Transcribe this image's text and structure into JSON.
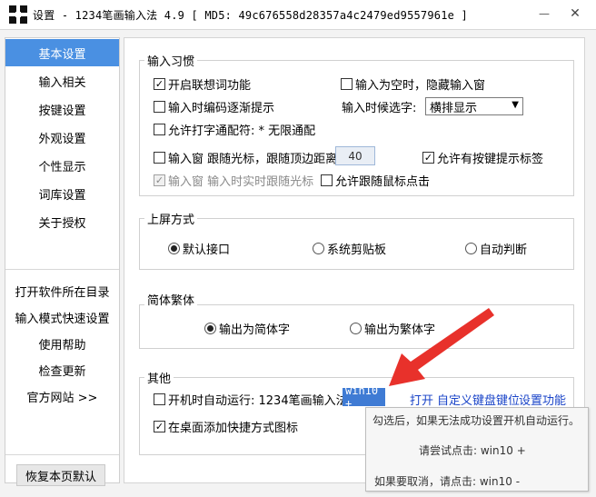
{
  "window": {
    "title": "设置 - 1234笔画输入法 4.9  [ MD5: 49c676558d28357a4c2479ed9557961e ]",
    "min_glyph": "—",
    "close_glyph": "✕"
  },
  "sidebar": {
    "items": [
      {
        "label": "基本设置",
        "active": true
      },
      {
        "label": "输入相关"
      },
      {
        "label": "按键设置"
      },
      {
        "label": "外观设置"
      },
      {
        "label": "个性显示"
      },
      {
        "label": "词库设置"
      },
      {
        "label": "关于授权"
      }
    ],
    "links": [
      {
        "label": "打开软件所在目录"
      },
      {
        "label": "输入模式快速设置"
      },
      {
        "label": "使用帮助"
      },
      {
        "label": "检查更新"
      },
      {
        "label": "官方网站 >>"
      }
    ],
    "restore_label": "恢复本页默认"
  },
  "groups": {
    "habits": {
      "title": "输入习惯",
      "assoc": {
        "label": "开启联想词功能",
        "checked": true
      },
      "hide_empty": {
        "label": "输入为空时，隐藏输入窗",
        "checked": false
      },
      "gradual_hint": {
        "label": "输入时编码逐渐提示",
        "checked": false
      },
      "candidate_label": "输入时候选字:",
      "candidate_value": "横排显示",
      "wildcard": {
        "label": "允许打字通配符: * 无限通配",
        "checked": false
      },
      "follow_cursor": {
        "label": "输入窗 跟随光标，跟随顶边距离:",
        "checked": false
      },
      "distance_value": "40",
      "key_hint_tag": {
        "label": "允许有按键提示标签",
        "checked": true
      },
      "realtime_follow": {
        "label": "输入窗 输入时实时跟随光标",
        "checked": true,
        "disabled": true
      },
      "mouse_click": {
        "label": "允许跟随鼠标点击",
        "checked": false
      }
    },
    "commit": {
      "title": "上屏方式",
      "options": [
        {
          "label": "默认接口",
          "selected": true
        },
        {
          "label": "系统剪贴板",
          "selected": false
        },
        {
          "label": "自动判断",
          "selected": false
        }
      ]
    },
    "script": {
      "title": "简体繁体",
      "options": [
        {
          "label": "输出为简体字",
          "selected": true
        },
        {
          "label": "输出为繁体字",
          "selected": false
        }
      ]
    },
    "other": {
      "title": "其他",
      "autostart": {
        "label": "开机时自动运行: 1234笔画输入法",
        "checked": false
      },
      "win_tag": "win10 +",
      "open_link": "打开",
      "custom_keys_link": "自定义键盘键位",
      "settings_link": "设置功能",
      "desktop_shortcut": {
        "label": "在桌面添加快捷方式图标",
        "checked": true
      }
    }
  },
  "tooltip": {
    "line1": "勾选后，如果无法成功设置开机自动运行。",
    "line2": "请尝试点击: win10 +",
    "line3": "如果要取消，请点击: win10 -"
  },
  "colors": {
    "accent": "#4a90e2",
    "link": "#1a44c8",
    "arrow": "#e8312b"
  }
}
